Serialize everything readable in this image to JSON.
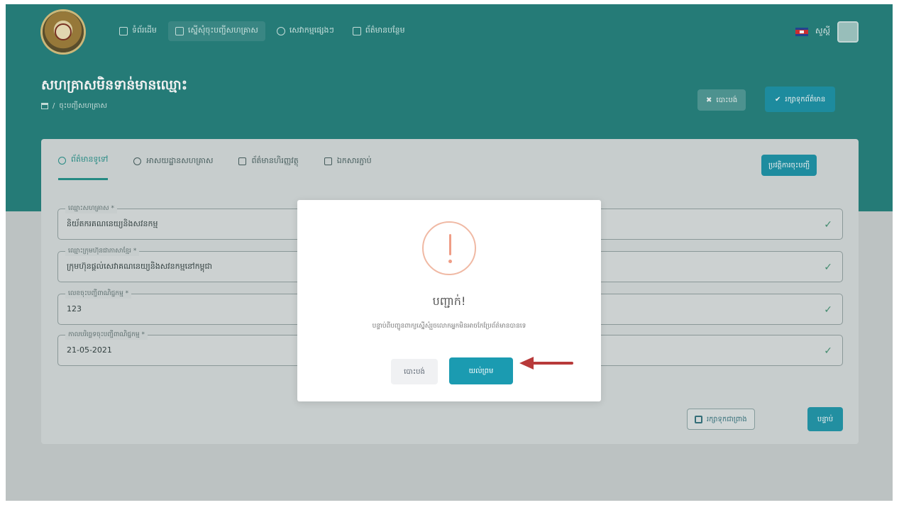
{
  "nav": {
    "items": [
      {
        "label": "ទំព័រដើម"
      },
      {
        "label": "ស្នើសុំចុះបញ្ជីសហគ្រាស"
      },
      {
        "label": "សេវាកម្មផ្សេងៗ"
      },
      {
        "label": "ព័ត៌មានបន្ថែម"
      }
    ],
    "user": "សួស្តី"
  },
  "header": {
    "title": "សហគ្រាសមិនទាន់មានឈ្មោះ",
    "breadcrumb": "ចុះបញ្ជីសហគ្រាស",
    "cancel_label": "បោះបង់",
    "save_label": "រក្សាទុកព័ត៌មាន"
  },
  "tabs": [
    {
      "label": "ព័ត៌មានទូទៅ",
      "active": true
    },
    {
      "label": "អាសយដ្ឋានសហគ្រាស",
      "active": false
    },
    {
      "label": "ព័ត៌មានហិរញ្ញវត្ថុ",
      "active": false
    },
    {
      "label": "ឯកសារភ្ជាប់",
      "active": false
    }
  ],
  "card_action": "ប្រវត្តិការចុះបញ្ជី",
  "fields": [
    {
      "label": "ឈ្មោះសហគ្រាស *",
      "value": "និយ័តករគណនេយ្យនិងសវនកម្ម"
    },
    {
      "label": "ឈ្មោះក្រុមហ៊ុនជាភាសាខ្មែរ *",
      "value": "ក្រុមហ៊ុនផ្តល់សេវាគណនេយ្យនិងសវនកម្មនៅកម្ពុជា"
    },
    {
      "label": "លេខចុះបញ្ជីពាណិជ្ជកម្ម *",
      "value": "123"
    },
    {
      "label": "កាលបរិច្ឆេទចុះបញ្ជីពាណិជ្ជកម្ម *",
      "value": "21-05-2021"
    }
  ],
  "footer": {
    "draft_label": "រក្សាទុកជាព្រាង",
    "next_label": "បន្ទាប់"
  },
  "modal": {
    "title": "បញ្ជាក់!",
    "message": "បន្ទាប់ពីបញ្ជូនពាក្យស្នើសុំរួចលោកអ្នកមិនអាចកែប្រែព័ត៌មានបានទេ",
    "cancel_label": "បោះបង់",
    "confirm_label": "យល់ព្រម"
  },
  "colors": {
    "brand": "#1f7d79",
    "accent": "#1b9bb1",
    "warning": "#ef9d86",
    "arrow": "#b83a3a"
  }
}
